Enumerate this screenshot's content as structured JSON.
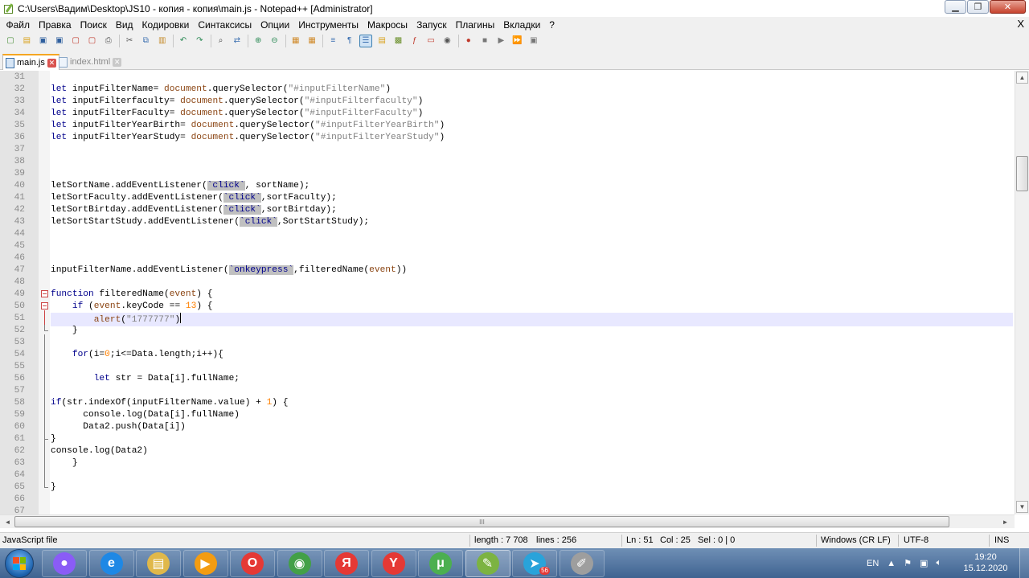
{
  "window": {
    "title": "C:\\Users\\Вадим\\Desktop\\JS10 - копия - копия\\main.js - Notepad++ [Administrator]",
    "minimize_glyph": "▁",
    "restore_glyph": "❐",
    "close_glyph": "✕"
  },
  "menu": {
    "items": [
      "Файл",
      "Правка",
      "Поиск",
      "Вид",
      "Кодировки",
      "Синтаксисы",
      "Опции",
      "Инструменты",
      "Макросы",
      "Запуск",
      "Плагины",
      "Вкладки",
      "?"
    ],
    "close_glyph": "X"
  },
  "toolbar": {
    "icons": [
      {
        "name": "new-file-icon",
        "glyph": "▢",
        "color": "#4a8f3a"
      },
      {
        "name": "open-file-icon",
        "glyph": "▤",
        "color": "#d9a21b"
      },
      {
        "name": "save-icon",
        "glyph": "▣",
        "color": "#2f5f9e"
      },
      {
        "name": "save-all-icon",
        "glyph": "▣",
        "color": "#2f5f9e"
      },
      {
        "name": "close-file-icon",
        "glyph": "▢",
        "color": "#c0392b"
      },
      {
        "name": "close-all-icon",
        "glyph": "▢",
        "color": "#c0392b"
      },
      {
        "name": "print-icon",
        "glyph": "⎙",
        "color": "#555555"
      },
      {
        "sep": true
      },
      {
        "name": "cut-icon",
        "glyph": "✂",
        "color": "#555555"
      },
      {
        "name": "copy-icon",
        "glyph": "⧉",
        "color": "#3b6fb0"
      },
      {
        "name": "paste-icon",
        "glyph": "▥",
        "color": "#c58b2a"
      },
      {
        "sep": true
      },
      {
        "name": "undo-icon",
        "glyph": "↶",
        "color": "#2e8b57"
      },
      {
        "name": "redo-icon",
        "glyph": "↷",
        "color": "#2e8b57"
      },
      {
        "sep": true
      },
      {
        "name": "find-icon",
        "glyph": "⌕",
        "color": "#444444"
      },
      {
        "name": "replace-icon",
        "glyph": "⇄",
        "color": "#3b6fb0"
      },
      {
        "sep": true
      },
      {
        "name": "zoom-in-icon",
        "glyph": "⊕",
        "color": "#2e8b57"
      },
      {
        "name": "zoom-out-icon",
        "glyph": "⊖",
        "color": "#2e8b57"
      },
      {
        "sep": true
      },
      {
        "name": "sync-vertical-icon",
        "glyph": "▦",
        "color": "#d08a2a"
      },
      {
        "name": "sync-horizontal-icon",
        "glyph": "▦",
        "color": "#d08a2a"
      },
      {
        "sep": true
      },
      {
        "name": "word-wrap-icon",
        "glyph": "≡",
        "color": "#3b6fb0"
      },
      {
        "name": "show-all-chars-icon",
        "glyph": "¶",
        "color": "#3b6fb0"
      },
      {
        "name": "indent-guide-icon",
        "glyph": "☰",
        "color": "#3b6fb0",
        "active": true
      },
      {
        "name": "user-language-icon",
        "glyph": "▤",
        "color": "#d9a21b"
      },
      {
        "name": "document-map-icon",
        "glyph": "▩",
        "color": "#6a8f2a"
      },
      {
        "name": "function-list-icon",
        "glyph": "ƒ",
        "color": "#c0392b"
      },
      {
        "name": "folder-workspace-icon",
        "glyph": "▭",
        "color": "#c0392b"
      },
      {
        "name": "monitoring-icon",
        "glyph": "◉",
        "color": "#555555"
      },
      {
        "sep": true
      },
      {
        "name": "record-macro-icon",
        "glyph": "●",
        "color": "#c0392b"
      },
      {
        "name": "stop-macro-icon",
        "glyph": "■",
        "color": "#777777"
      },
      {
        "name": "play-macro-icon",
        "glyph": "▶",
        "color": "#777777"
      },
      {
        "name": "run-macro-multiple-icon",
        "glyph": "⏩",
        "color": "#3b6fb0"
      },
      {
        "name": "save-macro-icon",
        "glyph": "▣",
        "color": "#777777"
      }
    ]
  },
  "tabs": [
    {
      "label": "main.js",
      "active": true
    },
    {
      "label": "index.html",
      "active": false
    }
  ],
  "editor": {
    "lines": [
      {
        "n": "31",
        "html": ""
      },
      {
        "n": "32",
        "html": "<span class='kw'>let</span> inputFilterName= <span class='fn'>document</span>.querySelector(<span class='str'>\"#inputFilterName\"</span>)"
      },
      {
        "n": "33",
        "html": "<span class='kw'>let</span> inputFilterfaculty= <span class='fn'>document</span>.querySelector(<span class='str'>\"#inputFilterfaculty\"</span>)"
      },
      {
        "n": "34",
        "html": "<span class='kw'>let</span> inputFilterFaculty= <span class='fn'>document</span>.querySelector(<span class='str'>\"#inputFilterFaculty\"</span>)"
      },
      {
        "n": "35",
        "html": "<span class='kw'>let</span> inputFilterYearBirth= <span class='fn'>document</span>.querySelector(<span class='str'>\"#inputFilterYearBirth\"</span>)"
      },
      {
        "n": "36",
        "html": "<span class='kw'>let</span> inputFilterYearStudy= <span class='fn'>document</span>.querySelector(<span class='str'>\"#inputFilterYearStudy\"</span>)"
      },
      {
        "n": "37",
        "html": ""
      },
      {
        "n": "38",
        "html": ""
      },
      {
        "n": "39",
        "html": ""
      },
      {
        "n": "40",
        "html": "letSortName.addEventListener(<span class='tpl'>`click`</span>, sortName);"
      },
      {
        "n": "41",
        "html": "letSortFaculty.addEventListener(<span class='tpl'>`click`</span>,sortFaculty);"
      },
      {
        "n": "42",
        "html": "letSortBirtday.addEventListener(<span class='tpl'>`click`</span>,sortBirtday);"
      },
      {
        "n": "43",
        "html": "letSortStartStudy.addEventListener(<span class='tpl'>`click`</span>,SortStartStudy);"
      },
      {
        "n": "44",
        "html": ""
      },
      {
        "n": "45",
        "html": ""
      },
      {
        "n": "46",
        "html": ""
      },
      {
        "n": "47",
        "html": "inputFilterName.addEventListener(<span class='tpl'>`onkeypress`</span>,filteredName(<span class='fn'>event</span>))"
      },
      {
        "n": "48",
        "html": ""
      },
      {
        "n": "49",
        "html": "<span class='kw'>function</span> filteredName(<span class='fn'>event</span>) {"
      },
      {
        "n": "50",
        "html": "    <span class='kw'>if</span> (<span class='fn'>event</span>.keyCode == <span class='num'>13</span>) {"
      },
      {
        "n": "51",
        "html": "        <span class='fn'>alert</span>(<span class='str'>\"1777777\"</span>)<span class='caret'></span>",
        "current": true
      },
      {
        "n": "52",
        "html": "    }"
      },
      {
        "n": "53",
        "html": ""
      },
      {
        "n": "54",
        "html": "    <span class='kw'>for</span>(i=<span class='num'>0</span>;i&lt;=Data.length;i++){"
      },
      {
        "n": "55",
        "html": ""
      },
      {
        "n": "56",
        "html": "        <span class='kw'>let</span> str = Data[i].fullName;"
      },
      {
        "n": "57",
        "html": ""
      },
      {
        "n": "58",
        "html": "<span class='kw'>if</span>(str.indexOf(inputFilterName.value) + <span class='num'>1</span>) {"
      },
      {
        "n": "59",
        "html": "      console.log(Data[i].fullName)"
      },
      {
        "n": "60",
        "html": "      Data2.push(Data[i])"
      },
      {
        "n": "61",
        "html": "}"
      },
      {
        "n": "62",
        "html": "console.log(Data2)"
      },
      {
        "n": "63",
        "html": "    }"
      },
      {
        "n": "64",
        "html": ""
      },
      {
        "n": "65",
        "html": "}"
      },
      {
        "n": "66",
        "html": ""
      },
      {
        "n": "67",
        "html": ""
      }
    ]
  },
  "scroll": {
    "up_glyph": "▲",
    "down_glyph": "▼",
    "left_glyph": "◄",
    "right_glyph": "►",
    "grip_glyph": "III"
  },
  "status": {
    "language": "JavaScript file",
    "length": "length : 7 708",
    "lines": "lines : 256",
    "ln": "Ln : 51",
    "col": "Col : 25",
    "sel": "Sel : 0 | 0",
    "eol": "Windows (CR LF)",
    "encoding": "UTF-8",
    "mode": "INS"
  },
  "taskbar": {
    "apps": [
      {
        "name": "alice-assistant-icon",
        "glyph": "●",
        "color": "#8a5cf6"
      },
      {
        "name": "internet-explorer-icon",
        "glyph": "e",
        "color": "#1e88e5"
      },
      {
        "name": "file-explorer-icon",
        "glyph": "▤",
        "color": "#e0b84a"
      },
      {
        "name": "media-player-icon",
        "glyph": "▶",
        "color": "#f39c12"
      },
      {
        "name": "opera-icon",
        "glyph": "O",
        "color": "#e53935"
      },
      {
        "name": "chrome-icon",
        "glyph": "◉",
        "color": "#43a047"
      },
      {
        "name": "yandex-icon",
        "glyph": "Я",
        "color": "#e53935"
      },
      {
        "name": "yandex-browser-icon",
        "glyph": "Y",
        "color": "#e53935"
      },
      {
        "name": "utorrent-icon",
        "glyph": "μ",
        "color": "#4caf50"
      },
      {
        "name": "notepad-plus-plus-icon",
        "glyph": "✎",
        "color": "#7cb342",
        "open": true
      },
      {
        "name": "telegram-icon",
        "glyph": "➤",
        "color": "#29a3da",
        "badge": "56"
      },
      {
        "name": "paint-icon",
        "glyph": "✐",
        "color": "#9e9e9e"
      }
    ],
    "lang": "EN",
    "time": "19:20",
    "date": "15.12.2020"
  }
}
